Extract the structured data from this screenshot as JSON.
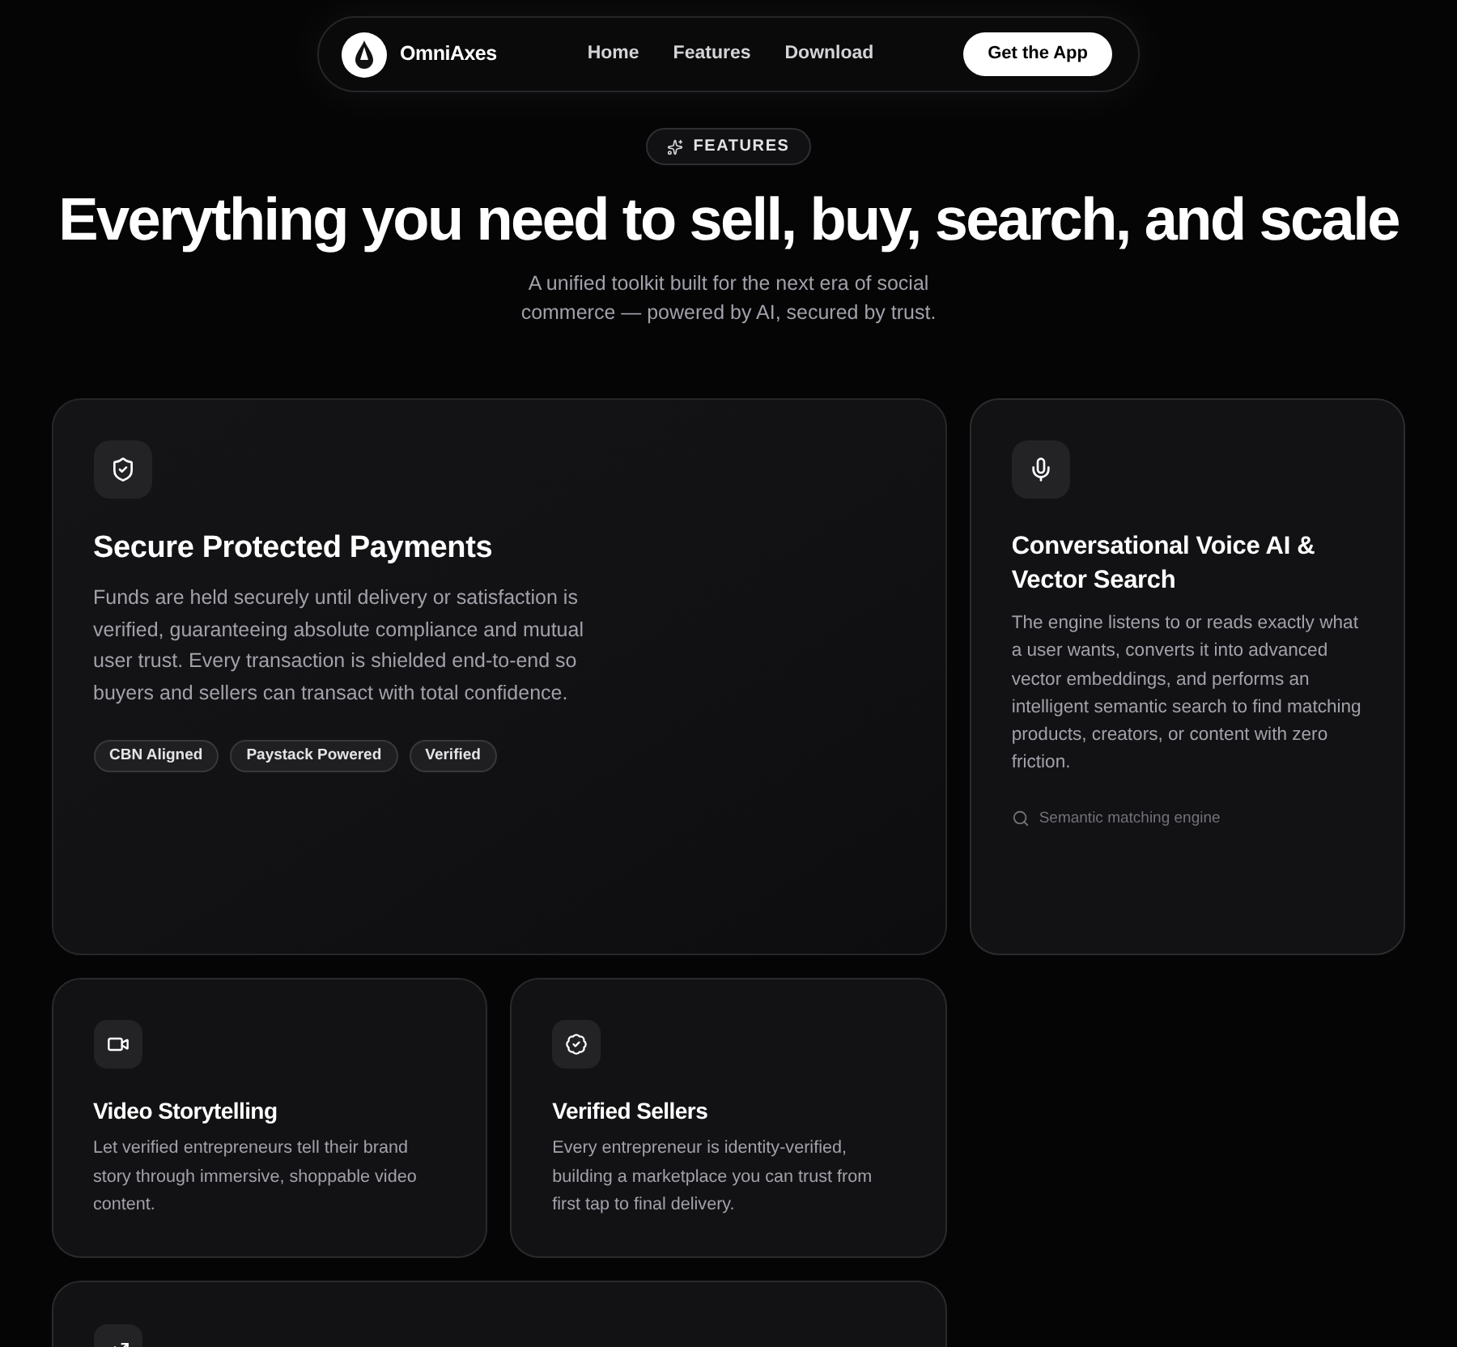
{
  "nav": {
    "brand": "OmniAxes",
    "links": [
      {
        "label": "Home"
      },
      {
        "label": "Features"
      },
      {
        "label": "Download"
      }
    ],
    "cta": "Get the App"
  },
  "hero": {
    "badge": "FEATURES",
    "title": "Everything you need to sell, buy, search, and scale",
    "subtitle": "A unified toolkit built for the next era of social commerce — powered by AI, secured by trust."
  },
  "features": [
    {
      "kind": "large",
      "title": "Secure Protected Payments",
      "description": "Funds are held securely until delivery or satisfaction is verified, guaranteeing absolute compliance and mutual user trust. Every transaction is shielded end-to-end so buyers and sellers can transact with total confidence.",
      "tags": [
        "CBN Aligned",
        "Paystack Powered",
        "Verified"
      ]
    },
    {
      "kind": "tall",
      "title": "Conversational Voice AI & Vector Search",
      "description": "The engine listens to or reads exactly what a user wants, converts it into advanced vector embeddings, and performs an intelligent semantic search to find matching products, creators, or content with zero friction.",
      "footnote": "Semantic matching engine"
    },
    {
      "kind": "small",
      "title": "Video Storytelling",
      "description": "Let verified entrepreneurs tell their brand story through immersive, shoppable video content."
    },
    {
      "kind": "small",
      "title": "Verified Sellers",
      "description": "Every entrepreneur is identity-verified, building a marketplace you can trust from first tap to final delivery."
    },
    {
      "kind": "wide"
    }
  ]
}
